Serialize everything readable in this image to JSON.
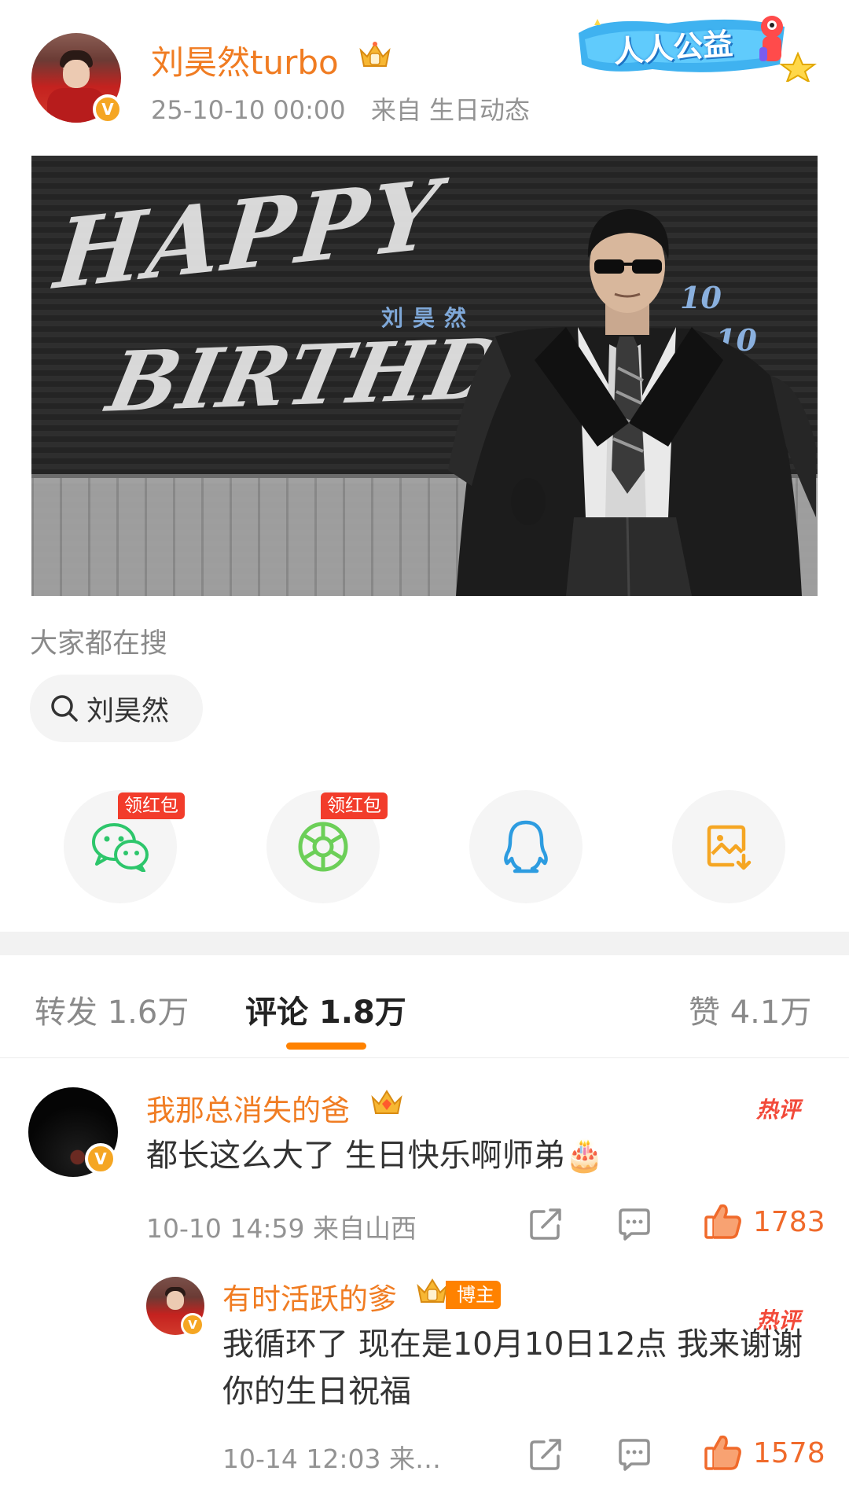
{
  "post": {
    "username": "刘昊然turbo",
    "timestamp": "25-10-10 00:00",
    "source": "来自 生日动态",
    "charity_badge": "人人公益",
    "banner": {
      "happy_text": "HAPPY",
      "birthday_text": "BIRTHDAY",
      "name_text": "刘昊然",
      "date_month": "10",
      "date_day": "10"
    }
  },
  "search": {
    "title": "大家都在搜",
    "chip_label": "刘昊然"
  },
  "share": {
    "wechat_tag": "领红包",
    "moments_tag": "领红包",
    "items": [
      "wechat",
      "moments",
      "qq",
      "save-image"
    ]
  },
  "tabs": {
    "repost": "转发 1.6万",
    "comment": "评论 1.8万",
    "like": "赞 4.1万"
  },
  "comments": [
    {
      "username": "我那总消失的爸",
      "text": "都长这么大了 生日快乐啊师弟🎂",
      "meta": "10-10 14:59  来自山西",
      "hot_label": "热评",
      "likes": "1783"
    },
    {
      "username": "有时活跃的爹",
      "role_tag": "博主",
      "text": "我循环了 现在是10月10日12点 我来谢谢你的生日祝福",
      "meta": "10-14 12:03  来…",
      "hot_label": "热评",
      "likes": "1578"
    }
  ],
  "colors": {
    "accent_orange": "#ff8200",
    "username_orange": "#f07c22",
    "hot_red": "#f24a3a",
    "tag_red": "#f23c2b",
    "vip_gold": "#f5a623"
  }
}
